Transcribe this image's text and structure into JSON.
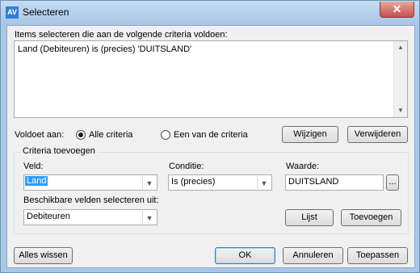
{
  "window": {
    "title": "Selecteren",
    "close_glyph": "✕",
    "icon": "app-logo-icon"
  },
  "criteria": {
    "prompt": "Items selecteren die aan de volgende criteria voldoen:",
    "lines": [
      "Land (Debiteuren) is (precies) 'DUITSLAND'"
    ]
  },
  "match": {
    "label": "Voldoet aan:",
    "options": [
      {
        "label": "Alle criteria",
        "selected": true
      },
      {
        "label": "Een van de criteria",
        "selected": false
      }
    ]
  },
  "buttons": {
    "wijzigen": "Wijzigen",
    "verwijderen": "Verwijderen",
    "lijst": "Lijst",
    "toevoegen": "Toevoegen",
    "alles_wissen": "Alles wissen",
    "ok": "OK",
    "annuleren": "Annuleren",
    "toepassen": "Toepassen",
    "browse": "..."
  },
  "add_group": {
    "title": "Criteria toevoegen",
    "veld_label": "Veld:",
    "veld_value": "Land",
    "conditie_label": "Conditie:",
    "conditie_value": "Is (precies)",
    "waarde_label": "Waarde:",
    "waarde_value": "DUITSLAND",
    "available_label": "Beschikbare velden selecteren uit:",
    "available_value": "Debiteuren"
  }
}
